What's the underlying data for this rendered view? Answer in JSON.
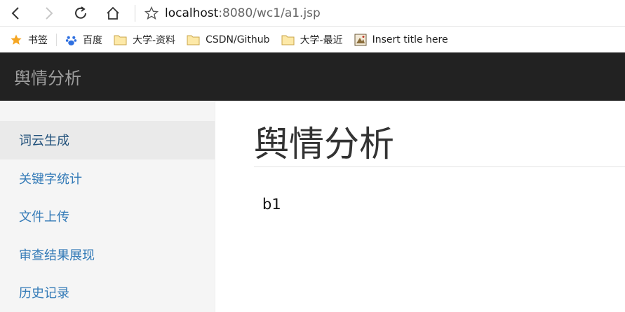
{
  "browser": {
    "url_host": "localhost",
    "url_rest": ":8080/wc1/a1.jsp",
    "bookmarks": [
      {
        "label": "书签",
        "icon": "star-icon"
      },
      {
        "label": "百度",
        "icon": "baidu-paw-icon"
      },
      {
        "label": "大学-资料",
        "icon": "folder-icon"
      },
      {
        "label": "CSDN/Github",
        "icon": "folder-icon"
      },
      {
        "label": "大学-最近",
        "icon": "folder-icon"
      },
      {
        "label": "Insert title here",
        "icon": "page-icon"
      }
    ]
  },
  "navbar": {
    "brand": "舆情分析"
  },
  "sidebar": {
    "items": [
      {
        "label": "词云生成",
        "active": true
      },
      {
        "label": "关键字统计",
        "active": false
      },
      {
        "label": "文件上传",
        "active": false
      },
      {
        "label": "审查结果展现",
        "active": false
      },
      {
        "label": "历史记录",
        "active": false
      }
    ]
  },
  "main": {
    "title": "舆情分析",
    "content": "b1"
  },
  "colors": {
    "navbar_bg": "#222222",
    "brand_text": "#9d9d9d",
    "link": "#337ab7",
    "sidebar_bg": "#f5f5f5",
    "active_bg": "#eaeaea"
  }
}
